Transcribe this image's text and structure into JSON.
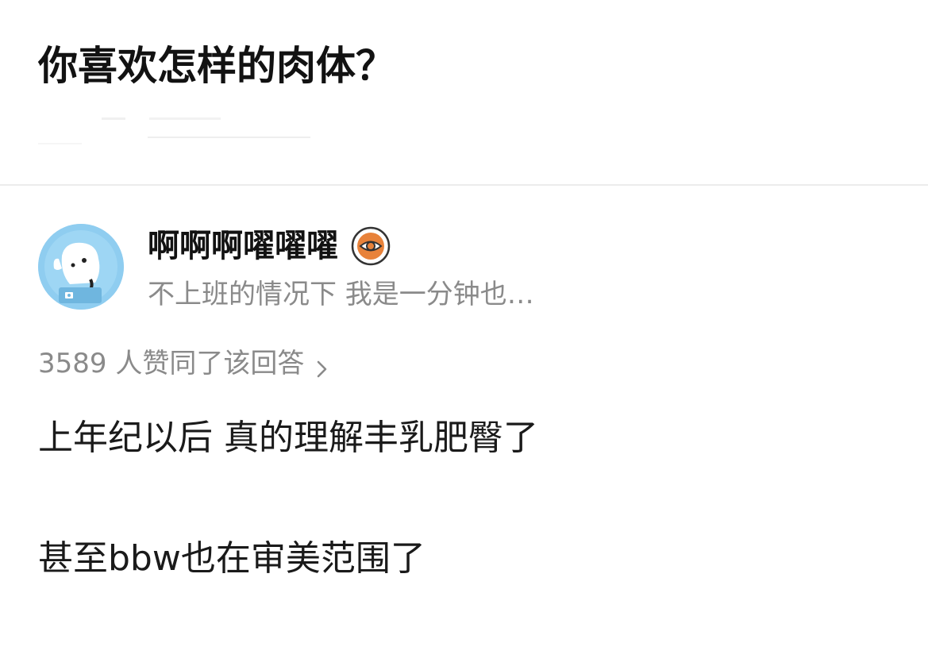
{
  "question": {
    "title": "你喜欢怎样的肉体？"
  },
  "answer": {
    "author": {
      "name": "啊啊啊嚁嚁嚁",
      "bio": "不上班的情况下 我是一分钟也…",
      "badge_icon": "eye-badge-icon",
      "avatar_icon": "dog-astronaut-avatar"
    },
    "vote_text": "3589 人赞同了该回答",
    "content": [
      "上年纪以后 真的理解丰乳肥臀了",
      "甚至bbw也在审美范围了"
    ]
  },
  "colors": {
    "title": "#121212",
    "muted": "#8a8a8a",
    "badge_orange": "#e8823a",
    "avatar_blue": "#8fcdf0",
    "divider": "#ececec"
  }
}
